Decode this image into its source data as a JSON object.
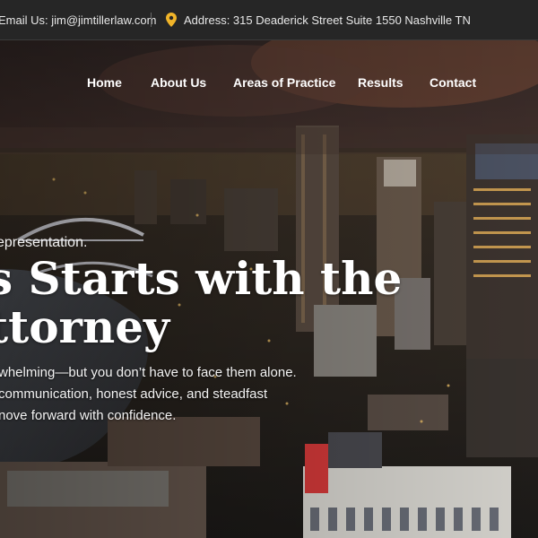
{
  "topbar": {
    "email_text": "Email Us: jim@jimtillerlaw.com",
    "address_text": "Address: 315 Deaderick Street Suite 1550 Nashville TN",
    "pin_icon": "map-pin-icon",
    "pin_color": "#f0b429"
  },
  "nav": {
    "items": [
      {
        "label": "Home"
      },
      {
        "label": "About Us"
      },
      {
        "label": "Areas of Practice"
      },
      {
        "label": "Results"
      },
      {
        "label": "Contact"
      }
    ]
  },
  "hero": {
    "tagline": "epresentation.",
    "headline_line1": "s Starts with the",
    "headline_line2": "ttorney",
    "sub_line1": "whelming—but you don’t have to face them alone.",
    "sub_line2": "communication, honest advice, and steadfast",
    "sub_line3": "nove forward with confidence."
  },
  "colors": {
    "topbar_bg": "#262626",
    "sky_top": "#2d2320",
    "sky_glow": "#8a4a2a"
  }
}
